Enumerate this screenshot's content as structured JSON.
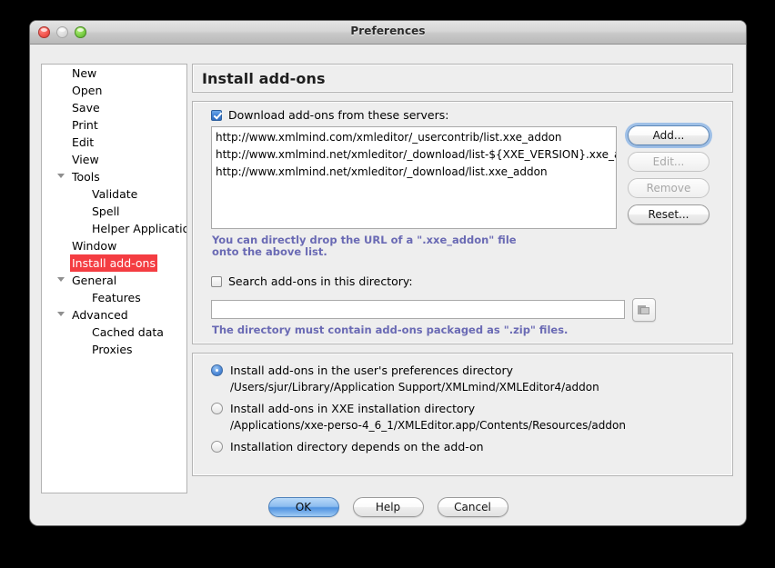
{
  "window": {
    "title": "Preferences",
    "traffic_lights": [
      {
        "name": "close",
        "color": "#f2514a",
        "enabled": true
      },
      {
        "name": "minimize",
        "color": "#d8d8d8",
        "enabled": false
      },
      {
        "name": "zoom",
        "color": "#77cc42",
        "enabled": true
      }
    ]
  },
  "sidebar": {
    "items": [
      {
        "label": "New",
        "level": 0,
        "arrow": false,
        "selected": false
      },
      {
        "label": "Open",
        "level": 0,
        "arrow": false,
        "selected": false
      },
      {
        "label": "Save",
        "level": 0,
        "arrow": false,
        "selected": false
      },
      {
        "label": "Print",
        "level": 0,
        "arrow": false,
        "selected": false
      },
      {
        "label": "Edit",
        "level": 0,
        "arrow": false,
        "selected": false
      },
      {
        "label": "View",
        "level": 0,
        "arrow": false,
        "selected": false
      },
      {
        "label": "Tools",
        "level": 0,
        "arrow": true,
        "selected": false
      },
      {
        "label": "Validate",
        "level": 1,
        "arrow": false,
        "selected": false
      },
      {
        "label": "Spell",
        "level": 1,
        "arrow": false,
        "selected": false
      },
      {
        "label": "Helper Applications",
        "level": 1,
        "arrow": false,
        "selected": false
      },
      {
        "label": "Window",
        "level": 0,
        "arrow": false,
        "selected": false
      },
      {
        "label": "Install add-ons",
        "level": 0,
        "arrow": false,
        "selected": true
      },
      {
        "label": "General",
        "level": 0,
        "arrow": true,
        "selected": false
      },
      {
        "label": "Features",
        "level": 1,
        "arrow": false,
        "selected": false
      },
      {
        "label": "Advanced",
        "level": 0,
        "arrow": true,
        "selected": false
      },
      {
        "label": "Cached data",
        "level": 1,
        "arrow": false,
        "selected": false
      },
      {
        "label": "Proxies",
        "level": 1,
        "arrow": false,
        "selected": false
      }
    ],
    "selection_color": "#f43d42"
  },
  "page": {
    "header_title": "Install add-ons"
  },
  "servers_group": {
    "download_checkbox": {
      "label": "Download add-ons from these servers:",
      "checked": true
    },
    "urls": [
      "http://www.xmlmind.com/xmleditor/_usercontrib/list.xxe_addon",
      "http://www.xmlmind.net/xmleditor/_download/list-${XXE_VERSION}.xxe_a...",
      "http://www.xmlmind.net/xmleditor/_download/list.xxe_addon"
    ],
    "buttons": [
      {
        "label": "Add...",
        "enabled": true,
        "focused": true
      },
      {
        "label": "Edit...",
        "enabled": false,
        "focused": false
      },
      {
        "label": "Remove",
        "enabled": false,
        "focused": false
      },
      {
        "label": "Reset...",
        "enabled": true,
        "focused": false
      }
    ],
    "drop_hint": "You can directly drop the URL of a \".xxe_addon\" file\nonto the above list.",
    "search_checkbox": {
      "label": "Search add-ons in this directory:",
      "checked": false
    },
    "directory_value": "",
    "directory_placeholder": "",
    "browse_icon": "folder-icon",
    "zip_hint": "The directory must contain add-ons packaged as \".zip\" files.",
    "hint_color": "#6a6ab4"
  },
  "location_group": {
    "options": [
      {
        "label": "Install add-ons in the user's preferences directory",
        "path": "/Users/sjur/Library/Application Support/XMLmind/XMLEditor4/addon",
        "selected": true
      },
      {
        "label": "Install add-ons in XXE installation directory",
        "path": "/Applications/xxe-perso-4_6_1/XMLEditor.app/Contents/Resources/addon",
        "selected": false
      },
      {
        "label": "Installation directory depends on the add-on",
        "path": "",
        "selected": false
      }
    ]
  },
  "footer": {
    "buttons": [
      {
        "label": "OK",
        "default": true
      },
      {
        "label": "Help",
        "default": false
      },
      {
        "label": "Cancel",
        "default": false
      }
    ]
  }
}
